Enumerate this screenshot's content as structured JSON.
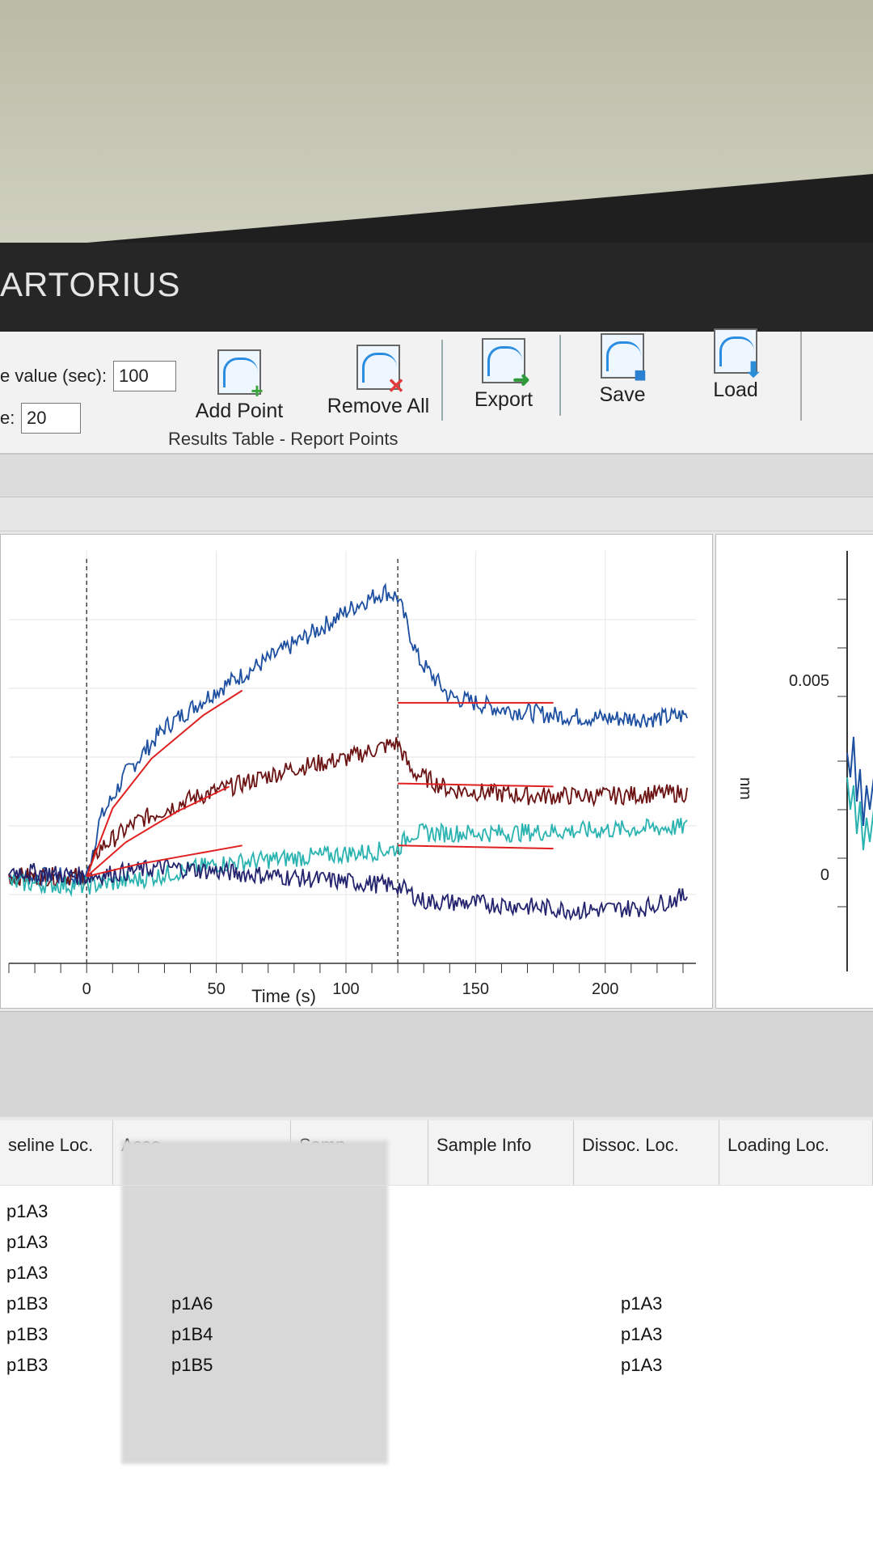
{
  "brand": "ARTORIUS",
  "fields": {
    "time_label": "e value (sec):",
    "time_value": "100",
    "size_label": "e:",
    "size_value": "20"
  },
  "toolbar": {
    "add_point": "Add Point",
    "remove_all": "Remove All",
    "group_label": "Results Table - Report Points",
    "export": "Export",
    "save": "Save",
    "load": "Load"
  },
  "chart_data": {
    "type": "line",
    "xlabel": "Time (s)",
    "xlim": [
      -30,
      235
    ],
    "ylim": [
      -0.028,
      0.105
    ],
    "x_ticks": [
      0,
      50,
      100,
      150,
      200
    ],
    "vlines": [
      0,
      120
    ],
    "series": [
      {
        "color": "#1d4fa0",
        "values": [
          [
            -30,
            0.0
          ],
          [
            0,
            0.0
          ],
          [
            5,
            0.018
          ],
          [
            15,
            0.033
          ],
          [
            30,
            0.048
          ],
          [
            50,
            0.06
          ],
          [
            70,
            0.07
          ],
          [
            90,
            0.08
          ],
          [
            105,
            0.088
          ],
          [
            115,
            0.092
          ],
          [
            120,
            0.09
          ],
          [
            128,
            0.07
          ],
          [
            140,
            0.058
          ],
          [
            160,
            0.054
          ],
          [
            180,
            0.052
          ],
          [
            200,
            0.051
          ],
          [
            220,
            0.051
          ],
          [
            232,
            0.052
          ]
        ]
      },
      {
        "color": "#6b1212",
        "values": [
          [
            -30,
            0.0
          ],
          [
            0,
            0.0
          ],
          [
            5,
            0.009
          ],
          [
            20,
            0.018
          ],
          [
            40,
            0.025
          ],
          [
            60,
            0.03
          ],
          [
            80,
            0.035
          ],
          [
            100,
            0.038
          ],
          [
            115,
            0.042
          ],
          [
            120,
            0.043
          ],
          [
            125,
            0.034
          ],
          [
            140,
            0.028
          ],
          [
            170,
            0.026
          ],
          [
            200,
            0.026
          ],
          [
            232,
            0.027
          ]
        ]
      },
      {
        "color": "#2ab3b0",
        "values": [
          [
            -30,
            -0.002
          ],
          [
            0,
            -0.003
          ],
          [
            20,
            -0.001
          ],
          [
            50,
            0.004
          ],
          [
            80,
            0.006
          ],
          [
            110,
            0.008
          ],
          [
            120,
            0.009
          ],
          [
            125,
            0.014
          ],
          [
            160,
            0.014
          ],
          [
            200,
            0.015
          ],
          [
            232,
            0.016
          ]
        ]
      },
      {
        "color": "#23236e",
        "values": [
          [
            -30,
            0.002
          ],
          [
            0,
            0.0
          ],
          [
            30,
            0.003
          ],
          [
            60,
            0.001
          ],
          [
            90,
            -0.001
          ],
          [
            120,
            -0.003
          ],
          [
            130,
            -0.008
          ],
          [
            160,
            -0.009
          ],
          [
            190,
            -0.011
          ],
          [
            215,
            -0.01
          ],
          [
            232,
            -0.006
          ]
        ]
      }
    ],
    "fits": [
      {
        "color": "#e02020",
        "values": [
          [
            0,
            0.0
          ],
          [
            10,
            0.022
          ],
          [
            25,
            0.038
          ],
          [
            45,
            0.052
          ],
          [
            60,
            0.06
          ]
        ]
      },
      {
        "color": "#e02020",
        "values": [
          [
            0,
            0.0
          ],
          [
            15,
            0.011
          ],
          [
            35,
            0.021
          ],
          [
            55,
            0.029
          ]
        ]
      },
      {
        "color": "#e02020",
        "values": [
          [
            0,
            0.0
          ],
          [
            20,
            0.004
          ],
          [
            40,
            0.007
          ],
          [
            60,
            0.01
          ]
        ]
      },
      {
        "color": "#e02020",
        "values": [
          [
            120,
            0.056
          ],
          [
            180,
            0.056
          ]
        ]
      },
      {
        "color": "#e02020",
        "values": [
          [
            120,
            0.03
          ],
          [
            180,
            0.029
          ]
        ]
      },
      {
        "color": "#e02020",
        "values": [
          [
            120,
            0.01
          ],
          [
            180,
            0.009
          ]
        ]
      }
    ]
  },
  "side_chart": {
    "ylabel": "nm",
    "tick_top": "0.005",
    "tick_mid": "0",
    "tick_bottom": "-"
  },
  "table": {
    "headers": [
      "seline Loc.",
      "Asso",
      "Samp",
      "Sample Info",
      "Dissoc. Loc.",
      "Loading Loc."
    ],
    "baseline": [
      "p1A3",
      "p1A3",
      "p1A3",
      "p1B3",
      "p1B3",
      "p1B3"
    ],
    "assoc": [
      "",
      "",
      "",
      "p1A6",
      "p1B4",
      "p1B5"
    ],
    "dissoc": [
      "",
      "",
      "",
      "p1A3",
      "p1A3",
      "p1A3"
    ]
  }
}
